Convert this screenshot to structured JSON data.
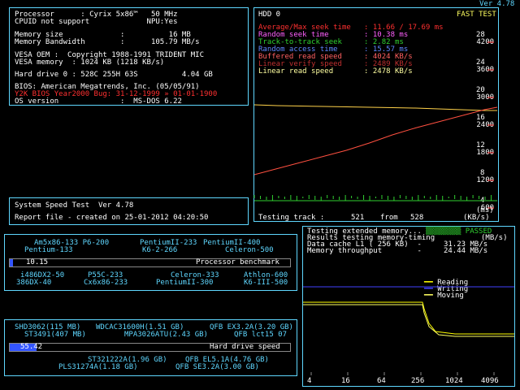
{
  "title": {
    "version": "Ver 4.78"
  },
  "sysinfo": {
    "processor_label": "Processor      : Cyrix 5x86™   50 MHz",
    "cpuid_label": "CPUID not support             NPU:Yes",
    "mem_size": "Memory size             :          16 MB",
    "mem_bw": "Memory Bandwidth        :      105.79 MB/s",
    "vesa_oem": "VESA OEM :  Copyright 1988-1991 TRIDENT MIC",
    "vesa_mem": "VESA memory  : 1024 KB (1218 KB/s)",
    "hdd": "Hard drive 0 : 528C 255H 63S          4.04 GB",
    "bios": "BIOS: American Megatrends, Inc. (05/05/91)",
    "y2k": "Y2K BIOS Year2000 Bug: 31-12-1999 » 01-01-1900",
    "os": "OS version              :  MS-DOS 6.22"
  },
  "speedtest": {
    "line1": "System Speed Test  Ver 4.78",
    "line2": "Report file - created on 25-01-2012 04:20:50"
  },
  "cpu_bench": {
    "value": "10.15",
    "caption": "Processor benchmark",
    "top_labels": [
      "Am5x86-133 P6-200",
      "PentiumII-233",
      "PentiumII-400",
      "Pentium-133",
      "K6-2-266",
      "Celeron-500"
    ],
    "bottom_labels": [
      "i486DX2-50",
      "P55C-233",
      "Celeron-333",
      "Athlon-600",
      "386DX-40",
      "Cx6x86-233",
      "PentiumII-300",
      "K6-III-500"
    ],
    "fill_fraction": 0.012
  },
  "hdd_bench": {
    "value": "55.42",
    "caption": "Hard drive speed",
    "top_labels": [
      "SHD3062(115 MB)",
      "WDCAC31600H(1.51 GB)",
      "QFB EX3.2A(3.20 GB)",
      "ST3491(407 MB)",
      "MPA3026ATU(2.43 GB)",
      "QFB lct15 07"
    ],
    "bottom_labels": [
      "ST321222A(1.96 GB)",
      "QFB EL5.1A(4.76 GB)",
      "PLS31274A(1.18 GB)",
      "QFB SE3.2A(3.00 GB)"
    ],
    "fill_fraction": 0.095
  },
  "hdd_panel": {
    "title": "HDD 0",
    "mode": "FAST TEST",
    "stats": [
      {
        "label": "Average/Max seek time   :",
        "value": "11.66 / 17.69 ms",
        "color": "#ff3030"
      },
      {
        "label": "Random seek time        :",
        "value": "10.38 ms",
        "color": "#ff60ff"
      },
      {
        "label": "Track-to-track seek     :",
        "value": "2.82 ms",
        "color": "#30d030"
      },
      {
        "label": "Random access time      :",
        "value": "15.57 ms",
        "color": "#5f87ff"
      },
      {
        "label": "Buffered read speed     :",
        "value": "4024 KB/s",
        "color": "#ff6060"
      },
      {
        "label": "Linear verify speed     :",
        "value": "2489 KB/s",
        "color": "#c03030"
      },
      {
        "label": "Linear read speed       :",
        "value": "2478 KB/s",
        "color": "#ffffa0"
      }
    ],
    "right_ticks_ms": [
      "28",
      "24",
      "20",
      "16",
      "12",
      "8",
      "4"
    ],
    "right_ticks_kbs": [
      "4200",
      "3600",
      "3000",
      "2400",
      "1800",
      "1200",
      "600"
    ],
    "footer_left": "Testing track :",
    "footer_track": "521",
    "footer_from": "from",
    "footer_total": "528",
    "unit_ms": "(ms)",
    "unit_kbs": "(KB/s)"
  },
  "mem_panel": {
    "line1": "Testing extended memory...",
    "status": "PASSED",
    "line2": "Results testing memory-timing",
    "unit": "(MB/s)",
    "line3": "Data cache L1 ( 256 KB)  -     31.23 MB/s",
    "line4": "Memory throughput        -     24.44 MB/s",
    "legend": [
      {
        "name": "Reading",
        "color": "#ffff00"
      },
      {
        "name": "Writing",
        "color": "#4040ff"
      },
      {
        "name": "Moving",
        "color": "#ffff60"
      }
    ],
    "x_ticks": [
      "4",
      "16",
      "64",
      "256",
      "1024",
      "4096"
    ]
  },
  "chart_data": [
    {
      "type": "line",
      "x": [
        0,
        50,
        100,
        150,
        200,
        250,
        300,
        350,
        400,
        450,
        500,
        528
      ],
      "series": [
        {
          "name": "Linear read speed",
          "values": [
            2620,
            2600,
            2590,
            2580,
            2570,
            2560,
            2550,
            2540,
            2520,
            2500,
            2480,
            2480
          ],
          "color": "#ffd24a"
        },
        {
          "name": "Linear verify speed",
          "values": [
            900,
            1050,
            1200,
            1350,
            1500,
            1680,
            1880,
            2050,
            2200,
            2350,
            2500,
            2560
          ],
          "color": "#ff5040"
        },
        {
          "name": "Track-to-track seek",
          "values": [
            2.8,
            2.8,
            2.8,
            2.8,
            2.8,
            2.8,
            2.8,
            2.8,
            2.8,
            2.8,
            2.8,
            2.8
          ],
          "color": "#30d030"
        }
      ],
      "ylim": [
        0,
        4200
      ]
    }
  ]
}
